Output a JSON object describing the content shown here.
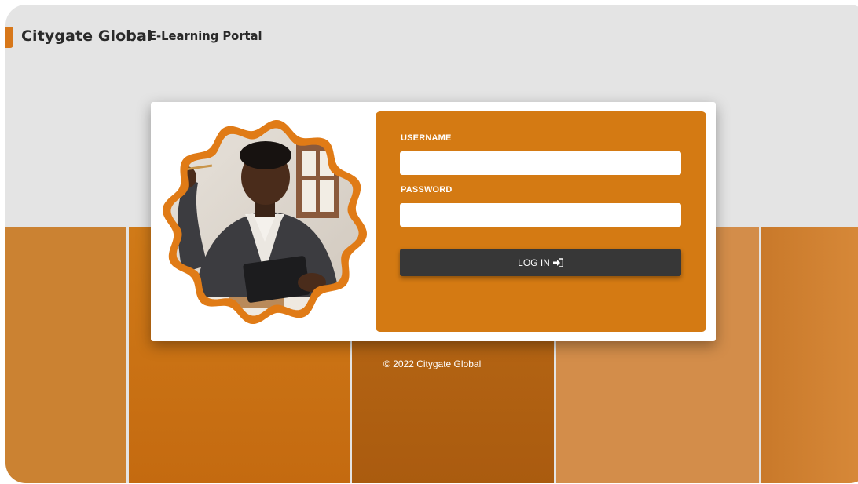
{
  "header": {
    "brand": "Citygate Global",
    "portal_title": "E-Learning Portal"
  },
  "login": {
    "username_label": "USERNAME",
    "username_value": "",
    "password_label": "PASSWORD",
    "password_value": "",
    "login_button": "LOG IN"
  },
  "footer": {
    "copyright": "© 2022 Citygate Global"
  },
  "icons": {
    "logo": "logo-icon",
    "login": "sign-in-icon"
  },
  "colors": {
    "accent": "#d47a13",
    "button": "#373737",
    "background": "#e4e4e4"
  }
}
